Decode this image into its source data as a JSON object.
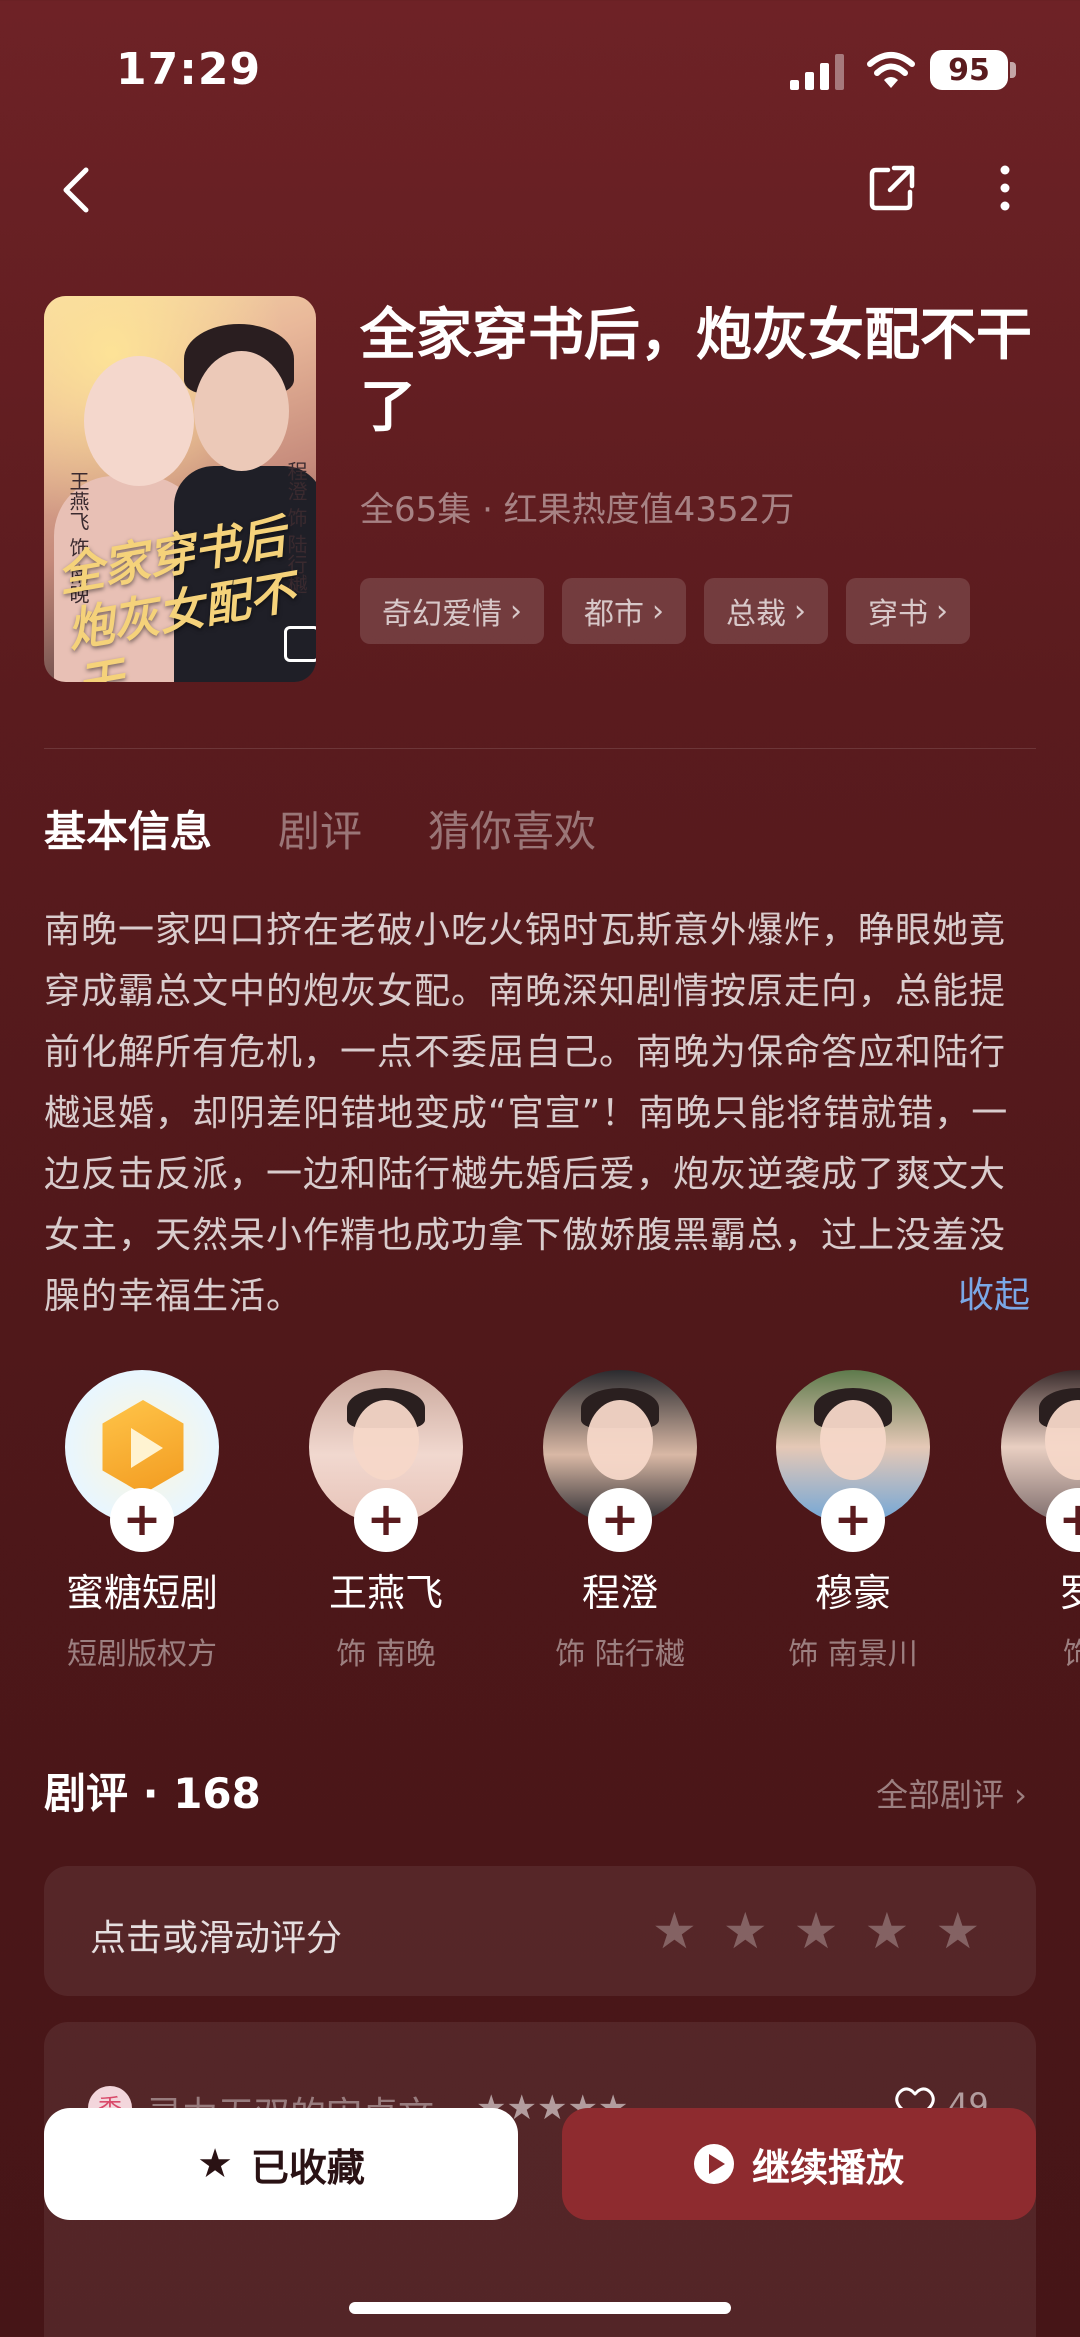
{
  "status_bar": {
    "time": "17:29",
    "battery": "95"
  },
  "show": {
    "title": "全家穿书后，炮灰女配不干了",
    "meta": "全65集 · 红果热度值4352万",
    "poster_title": "全家穿书后 炮灰女配不干",
    "poster_cast_a": "王燕飞 饰 南晚",
    "poster_cast_b": "程澄 饰 陆行樾",
    "tags": [
      {
        "label": "奇幻爱情",
        "arrow": "›"
      },
      {
        "label": "都市",
        "arrow": "›"
      },
      {
        "label": "总裁",
        "arrow": "›"
      },
      {
        "label": "穿书",
        "arrow": "›"
      }
    ]
  },
  "tabs": [
    {
      "label": "基本信息"
    },
    {
      "label": "剧评"
    },
    {
      "label": "猜你喜欢"
    }
  ],
  "synopsis": {
    "text": "南晚一家四口挤在老破小吃火锅时瓦斯意外爆炸，睁眼她竟穿成霸总文中的炮灰女配。南晚深知剧情按原走向，总能提前化解所有危机，一点不委屈自己。南晚为保命答应和陆行樾退婚，却阴差阳错地变成“官宣”！南晚只能将错就错，一边反击反派，一边和陆行樾先婚后爱，炮灰逆袭成了爽文大女主，天然呆小作精也成功拿下傲娇腹黑霸总，过上没羞没臊的幸福生活。",
    "collapse_label": "收起"
  },
  "cast": [
    {
      "name": "蜜糖短剧",
      "role": "短剧版权方",
      "add": "+"
    },
    {
      "name": "王燕飞",
      "role": "饰 南晚",
      "add": "+"
    },
    {
      "name": "程澄",
      "role": "饰 陆行樾",
      "add": "+"
    },
    {
      "name": "穆豪",
      "role": "饰 南景川",
      "add": "+"
    },
    {
      "name": "罗",
      "role": "饰",
      "add": "+"
    }
  ],
  "reviews": {
    "heading": "剧评 · 168",
    "all_label": "全部剧评 ›",
    "rate_prompt": "点击或滑动评分",
    "star_glyph": "★",
    "first": {
      "avatar_text": "秀",
      "username": "灵力无双的宋卓文",
      "stars": "★★★★★",
      "likes": "49"
    }
  },
  "actions": {
    "favorite_label": "已收藏",
    "favorite_icon": "★",
    "play_label": "继续播放"
  },
  "colors": {
    "background": "#5a1b1e",
    "accent_link": "#7aa7e6",
    "play_button": "#8e2b2f"
  }
}
